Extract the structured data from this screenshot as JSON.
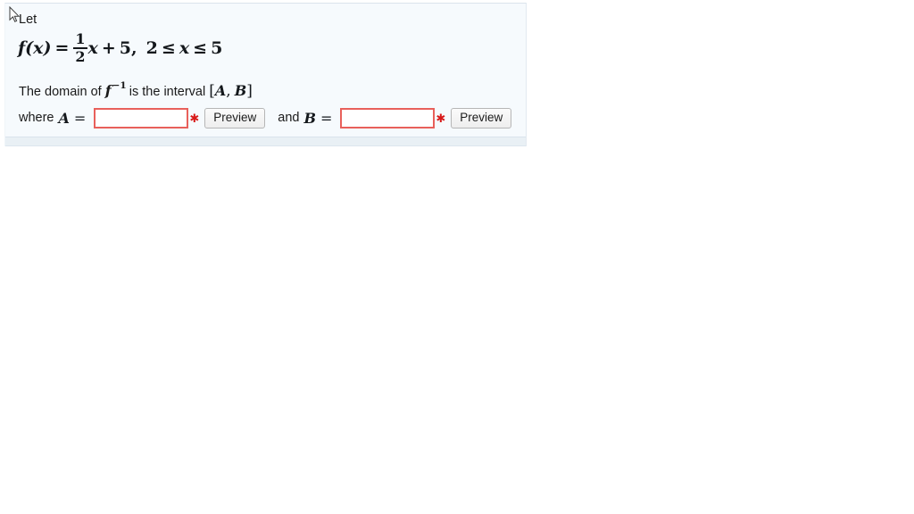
{
  "problem": {
    "intro_label": "Let",
    "formula": {
      "lhs": "f(x)",
      "equals": "=",
      "fraction_numerator": "1",
      "fraction_denominator": "2",
      "variable": "x",
      "plus": "+",
      "constant": "5",
      "comma": ",",
      "domain_lower": "2",
      "domain_rel_left": "≤",
      "domain_var": "x",
      "domain_rel_right": "≤",
      "domain_upper": "5",
      "plain_text": "f(x) = 1/2 x + 5,  2 ≤ x ≤ 5"
    },
    "statement": {
      "prefix": "The domain of",
      "function_symbol": "f",
      "function_exponent": "−1",
      "middle": "is the interval",
      "bracket_open": "[",
      "interval_start": "A",
      "interval_comma": ",",
      "interval_end": "B",
      "bracket_close": "]",
      "plain_text": "The domain of f−1 is the interval [A, B]"
    },
    "answers": {
      "where_label": "where",
      "and_label": "and",
      "equals": "=",
      "a": {
        "variable": "A",
        "value": "",
        "placeholder": "",
        "required_marker": "✱",
        "preview_label": "Preview"
      },
      "b": {
        "variable": "B",
        "value": "",
        "placeholder": "",
        "required_marker": "✱",
        "preview_label": "Preview"
      }
    }
  },
  "colors": {
    "panel_background": "#f6fafd",
    "panel_footer": "#e9f0f5",
    "input_border": "#e8605b",
    "required_marker": "#d81b1b",
    "text": "#1a1a1a"
  }
}
